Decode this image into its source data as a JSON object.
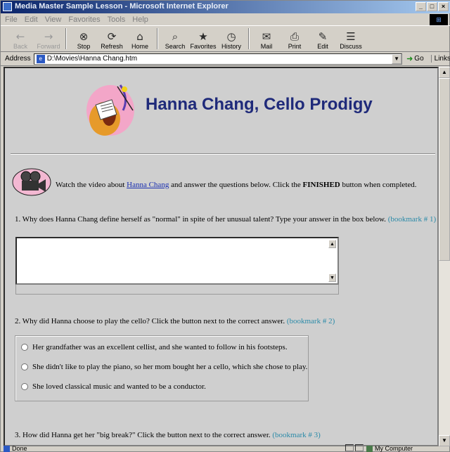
{
  "window": {
    "title": "Media Master Sample Lesson - Microsoft Internet Explorer",
    "controls": [
      "_",
      "□",
      "×"
    ]
  },
  "menu": [
    "File",
    "Edit",
    "View",
    "Favorites",
    "Tools",
    "Help"
  ],
  "toolbar": [
    {
      "label": "Back",
      "icon": "back-arrow-icon",
      "glyph": "←",
      "disabled": true
    },
    {
      "label": "Forward",
      "icon": "forward-arrow-icon",
      "glyph": "→",
      "disabled": true
    },
    {
      "label": "Stop",
      "icon": "stop-icon",
      "glyph": "⊗"
    },
    {
      "label": "Refresh",
      "icon": "refresh-icon",
      "glyph": "⟳"
    },
    {
      "label": "Home",
      "icon": "home-icon",
      "glyph": "⌂"
    },
    {
      "label": "Search",
      "icon": "search-icon",
      "glyph": "⌕"
    },
    {
      "label": "Favorites",
      "icon": "favorites-icon",
      "glyph": "★"
    },
    {
      "label": "History",
      "icon": "history-icon",
      "glyph": "◷"
    },
    {
      "label": "Mail",
      "icon": "mail-icon",
      "glyph": "✉"
    },
    {
      "label": "Print",
      "icon": "print-icon",
      "glyph": "⎙"
    },
    {
      "label": "Edit",
      "icon": "edit-icon",
      "glyph": "✎"
    },
    {
      "label": "Discuss",
      "icon": "discuss-icon",
      "glyph": "☰"
    }
  ],
  "address": {
    "label": "Address",
    "value": "D:\\Movies\\Hanna Chang.htm",
    "go_label": "Go",
    "links_label": "Links"
  },
  "page": {
    "title": "Hanna Chang, Cello Prodigy",
    "intro": {
      "prefix": "Watch the video about ",
      "link": "Hanna Chang",
      "middle": " and answer the questions below.  Click the ",
      "bold": "FINISHED",
      "suffix": " button when completed."
    },
    "questions": [
      {
        "text": "1.  Why does Hanna Chang define herself as \"normal\" in spite of her unusual talent?  Type your answer in the box below.",
        "bookmark": "(bookmark # 1)"
      },
      {
        "text": "2.  Why did Hanna choose to play the cello?  Click the button next to the correct answer.",
        "bookmark": "(bookmark # 2)",
        "options": [
          "Her grandfather was an excellent cellist, and she wanted to follow in his footsteps.",
          "She didn't like to play the piano, so her mom bought her a cello, which she chose to play.",
          "She loved classical music and wanted to be a conductor."
        ]
      },
      {
        "text": "3.  How did Hanna get her \"big break?\"  Click the button next to the correct answer.",
        "bookmark": "(bookmark # 3)"
      }
    ]
  },
  "status": {
    "left": "Done",
    "zone": "My Computer"
  }
}
